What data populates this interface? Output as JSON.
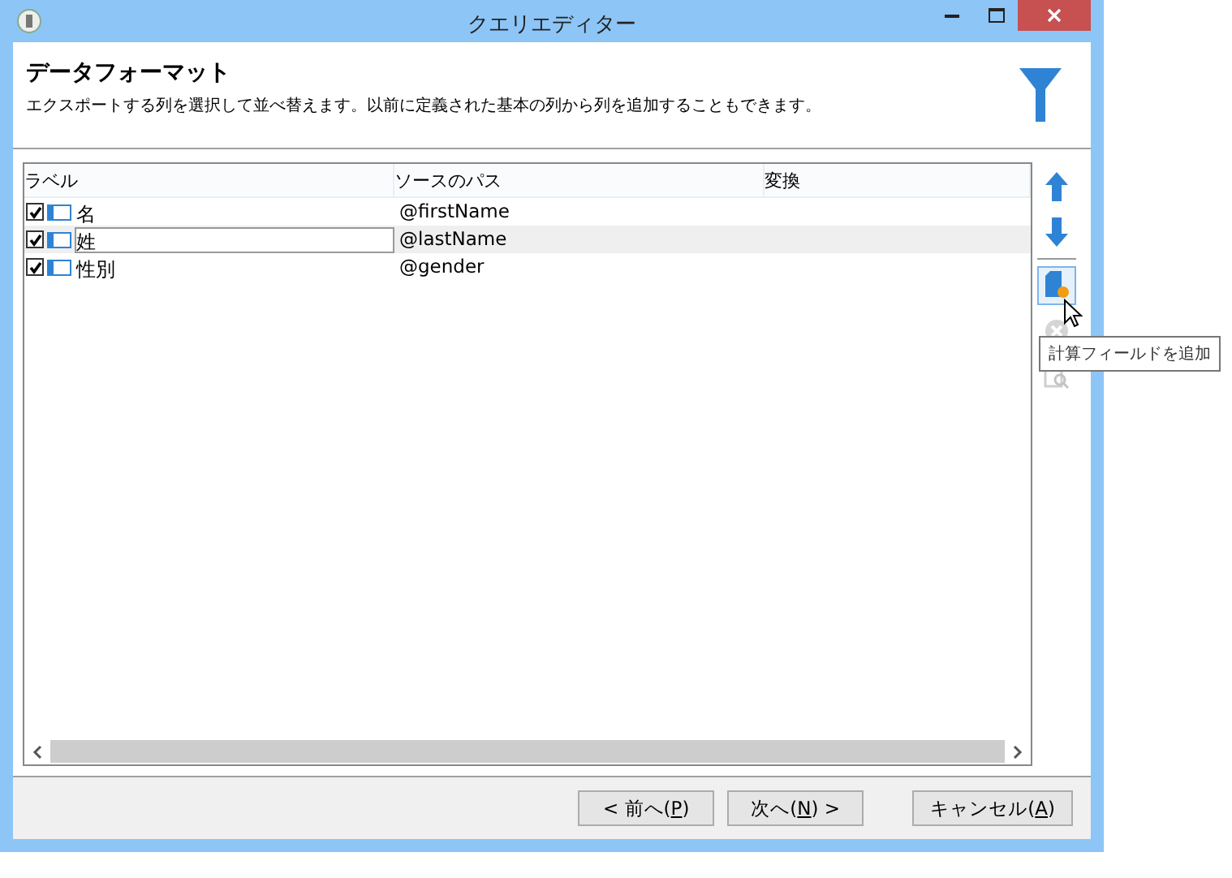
{
  "window": {
    "title": "クエリエディター"
  },
  "header": {
    "title": "データフォーマット",
    "description": "エクスポートする列を選択して並べ替えます。以前に定義された基本の列から列を追加することもできます。"
  },
  "table": {
    "columns": [
      "ラベル",
      "ソースのパス",
      "変換"
    ],
    "rows": [
      {
        "checked": true,
        "label": "名",
        "path": "@firstName",
        "selected": false,
        "editing": false
      },
      {
        "checked": true,
        "label": "姓",
        "path": "@lastName",
        "selected": true,
        "editing": true
      },
      {
        "checked": true,
        "label": "性別",
        "path": "@gender",
        "selected": false,
        "editing": false
      }
    ]
  },
  "tools": [
    {
      "kind": "up",
      "disabled": false,
      "hovered": false
    },
    {
      "kind": "down",
      "disabled": false,
      "hovered": false
    },
    {
      "kind": "separator"
    },
    {
      "kind": "calc",
      "disabled": false,
      "hovered": true
    },
    {
      "kind": "delete",
      "disabled": true,
      "hovered": false
    },
    {
      "kind": "preview",
      "disabled": true,
      "hovered": false
    }
  ],
  "tooltip": "計算フィールドを追加",
  "buttons": [
    {
      "before": "< 前へ(",
      "mnemonic": "P",
      "after": ")"
    },
    {
      "before": "次へ(",
      "mnemonic": "N",
      "after": ") >"
    },
    {
      "before": "キャンセル(",
      "mnemonic": "A",
      "after": ")"
    }
  ]
}
